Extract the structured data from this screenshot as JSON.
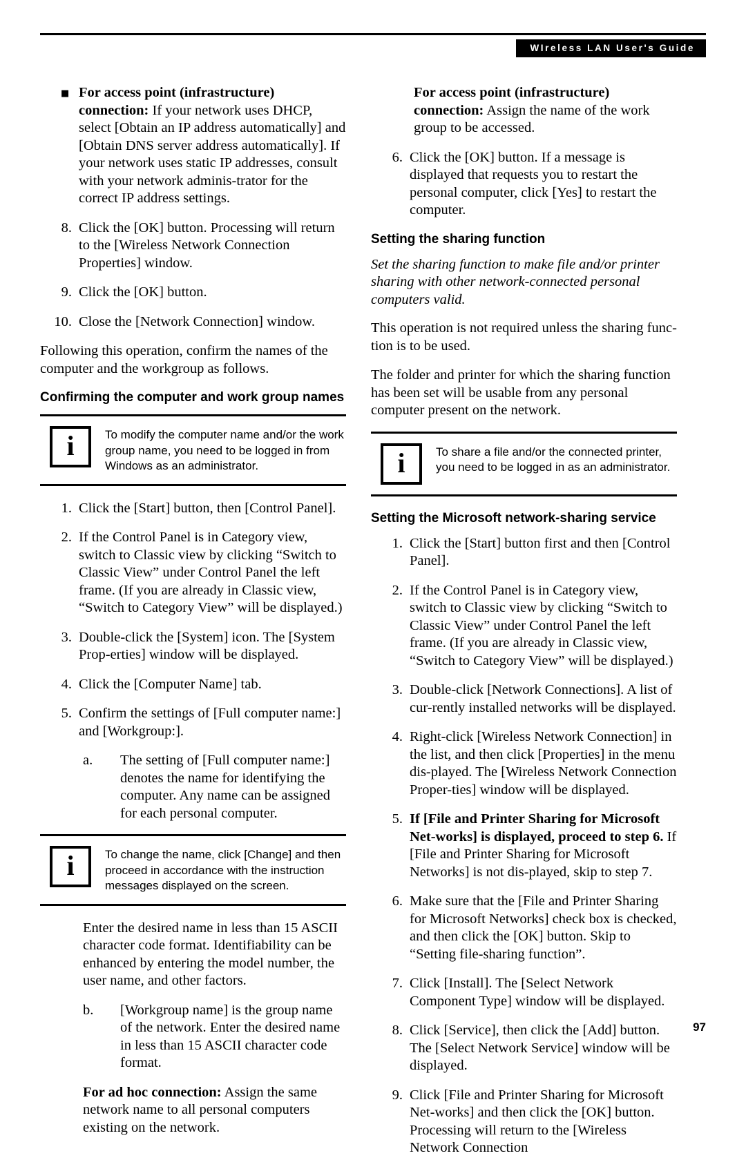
{
  "header": {
    "title": "WIreless LAN User's Guide"
  },
  "footer": {
    "page_number": "97"
  },
  "left_column": {
    "bullet_1": {
      "bullet": "■",
      "bold_lead": "For access point (infrastructure) connection:",
      "text": " If your network uses DHCP, select [Obtain an IP address automatically] and [Obtain DNS server address automatically]. If your network uses static IP addresses, consult with your network adminis-trator for the correct IP address settings."
    },
    "item_8": {
      "num": "8.",
      "text": "Click the [OK] button. Processing will return to the [Wireless Network Connection Properties] window."
    },
    "item_9": {
      "num": "9.",
      "text": "Click the [OK] button."
    },
    "item_10": {
      "num": "10.",
      "text": "Close the [Network Connection] window."
    },
    "para_following": "Following this operation, confirm the names of the computer and the workgroup as follows.",
    "heading_confirming": "Confirming the computer and work group names",
    "note_1": {
      "icon": "i",
      "text": "To modify the computer name and/or the work group name, you need to be logged in from Windows as an administrator."
    },
    "item_1": {
      "num": "1.",
      "text": "Click the [Start] button, then [Control Panel]."
    },
    "item_2": {
      "num": "2.",
      "text": "If the Control Panel is in Category view, switch to Classic view by clicking “Switch to Classic View” under Control Panel the left frame. (If you are already in Classic view, “Switch to Category View” will be displayed.)"
    },
    "item_3": {
      "num": "3.",
      "text": "Double-click the [System] icon. The [System Prop-erties] window will be displayed."
    },
    "item_4": {
      "num": "4.",
      "text": "Click the [Computer Name] tab."
    },
    "item_5": {
      "num": "5.",
      "text": "Confirm the settings of [Full computer name:] and [Workgroup:]."
    },
    "item_5a": {
      "label": "a.",
      "text": "The setting of [Full computer name:] denotes the name for identifying the computer. Any name can be assigned for each personal computer."
    },
    "note_2": {
      "icon": "i",
      "text": "To change the name, click [Change] and then proceed in accordance with the instruction messages displayed on the screen."
    },
    "para_enter": "Enter the desired name in less than 15 ASCII character code format. Identifiability can be enhanced by entering the model number, the user name, and other factors.",
    "item_5b": {
      "label": "b.",
      "text": "[Workgroup name] is the group name of the network. Enter the desired name in less than 15 ASCII character code format."
    },
    "adhoc": {
      "bold_lead": "For ad hoc connection:",
      "text": " Assign the same network name to all personal computers existing on the network."
    }
  },
  "right_column": {
    "accesspoint": {
      "bold_lead": "For access point (infrastructure) connection:",
      "text": " Assign the name of the work group to be accessed."
    },
    "item_6": {
      "num": "6.",
      "text": "Click the [OK] button. If a message is displayed that requests you to restart the personal computer, click [Yes] to restart the computer."
    },
    "heading_sharing": "Setting the sharing function",
    "italic_sharing": "Set the sharing function to make file and/or printer sharing with other network-connected personal computers valid.",
    "para_operation": "This operation is not required unless the sharing func-tion is to be used.",
    "para_folder": "The folder and printer for which the sharing function has been set will be usable from any personal computer present on the network.",
    "note_3": {
      "icon": "i",
      "text": "To share a file and/or the connected printer, you need to be logged in as an administrator."
    },
    "heading_ms_service": "Setting the Microsoft network-sharing service",
    "item_1": {
      "num": "1.",
      "text": "Click the [Start] button first and then [Control Panel]."
    },
    "item_2": {
      "num": "2.",
      "text": "If the Control Panel is in Category view, switch to Classic view by clicking “Switch to Classic View” under Control Panel the left frame. (If you are already in Classic view, “Switch to Category View” will be displayed.)"
    },
    "item_3": {
      "num": "3.",
      "text": "Double-click [Network Connections]. A list of cur-rently installed networks will be displayed."
    },
    "item_4": {
      "num": "4.",
      "text": "Right-click [Wireless Network Connection] in the list, and then click [Properties] in the menu dis-played. The [Wireless Network Connection Proper-ties] window will be displayed."
    },
    "item_5": {
      "num": "5.",
      "bold_part": "If [File and Printer Sharing for Microsoft Net-works] is displayed, proceed to step 6.",
      "rest": " If [File and Printer Sharing for Microsoft Networks] is not dis-played, skip to step 7."
    },
    "item_6b": {
      "num": "6.",
      "text": "Make sure that the [File and Printer Sharing for Microsoft Networks] check box is checked, and then click the [OK] button. Skip to “Setting file-sharing function”."
    },
    "item_7": {
      "num": "7.",
      "text": "Click [Install]. The [Select Network Component Type] window will be displayed."
    },
    "item_8": {
      "num": "8.",
      "text": "Click [Service], then click the [Add] button. The [Select Network Service] window will be displayed."
    },
    "item_9": {
      "num": "9.",
      "text": "Click [File and Printer Sharing for Microsoft Net-works] and then click the [OK] button. Processing will return to the [Wireless Network Connection"
    }
  }
}
